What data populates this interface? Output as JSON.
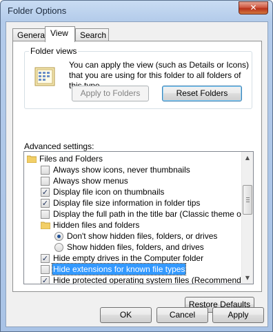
{
  "window": {
    "title": "Folder Options",
    "close_glyph": "✕"
  },
  "tabs": [
    {
      "label": "General",
      "active": false
    },
    {
      "label": "View",
      "active": true
    },
    {
      "label": "Search",
      "active": false
    }
  ],
  "folder_views": {
    "label": "Folder views",
    "description": "You can apply the view (such as Details or Icons) that you are using for this folder to all folders of this type.",
    "apply_button": "Apply to Folders",
    "reset_button": "Reset Folders",
    "icon": "folder-view-icon"
  },
  "advanced": {
    "label": "Advanced settings:",
    "items": [
      {
        "kind": "folder",
        "label": "Files and Folders"
      },
      {
        "kind": "checkbox",
        "label": "Always show icons, never thumbnails",
        "checked": false
      },
      {
        "kind": "checkbox",
        "label": "Always show menus",
        "checked": false
      },
      {
        "kind": "checkbox",
        "label": "Display file icon on thumbnails",
        "checked": true
      },
      {
        "kind": "checkbox",
        "label": "Display file size information in folder tips",
        "checked": true
      },
      {
        "kind": "checkbox",
        "label": "Display the full path in the title bar (Classic theme only)",
        "checked": false
      },
      {
        "kind": "folder",
        "label": "Hidden files and folders"
      },
      {
        "kind": "radio",
        "label": "Don't show hidden files, folders, or drives",
        "checked": true
      },
      {
        "kind": "radio",
        "label": "Show hidden files, folders, and drives",
        "checked": false
      },
      {
        "kind": "checkbox",
        "label": "Hide empty drives in the Computer folder",
        "checked": true
      },
      {
        "kind": "checkbox",
        "label": "Hide extensions for known file types",
        "checked": false,
        "selected": true
      },
      {
        "kind": "checkbox",
        "label": "Hide protected operating system files (Recommended)",
        "checked": true
      }
    ]
  },
  "restore_button": "Restore Defaults",
  "dialog_buttons": {
    "ok": "OK",
    "cancel": "Cancel",
    "apply": "Apply"
  },
  "colors": {
    "selection": "#3399ff",
    "title_bar": "#b3cbea",
    "close_button": "#c9452b"
  }
}
